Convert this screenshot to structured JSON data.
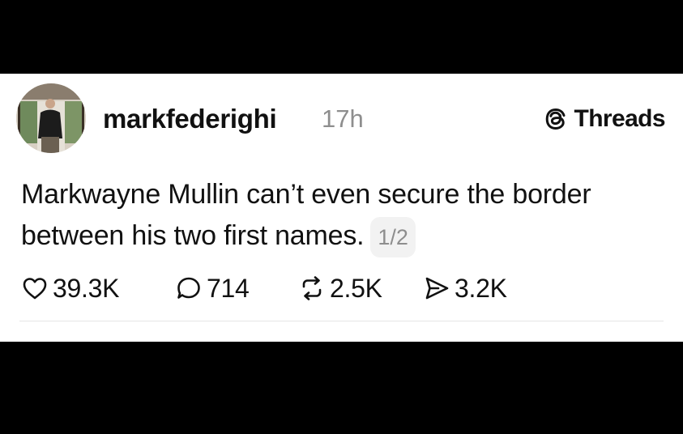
{
  "post": {
    "author": {
      "username": "markfederighi",
      "time": "17h"
    },
    "brand": {
      "icon": "threads-logo-icon",
      "name": "Threads"
    },
    "text": "Markwayne Mullin can’t even secure the border between his two first names.",
    "thread_position": "1/2",
    "stats": {
      "likes": "39.3K",
      "replies": "714",
      "reposts": "2.5K",
      "shares": "3.2K"
    }
  },
  "colors": {
    "background": "#000000",
    "card": "#ffffff",
    "text": "#111111",
    "muted": "#8e8e8e"
  }
}
